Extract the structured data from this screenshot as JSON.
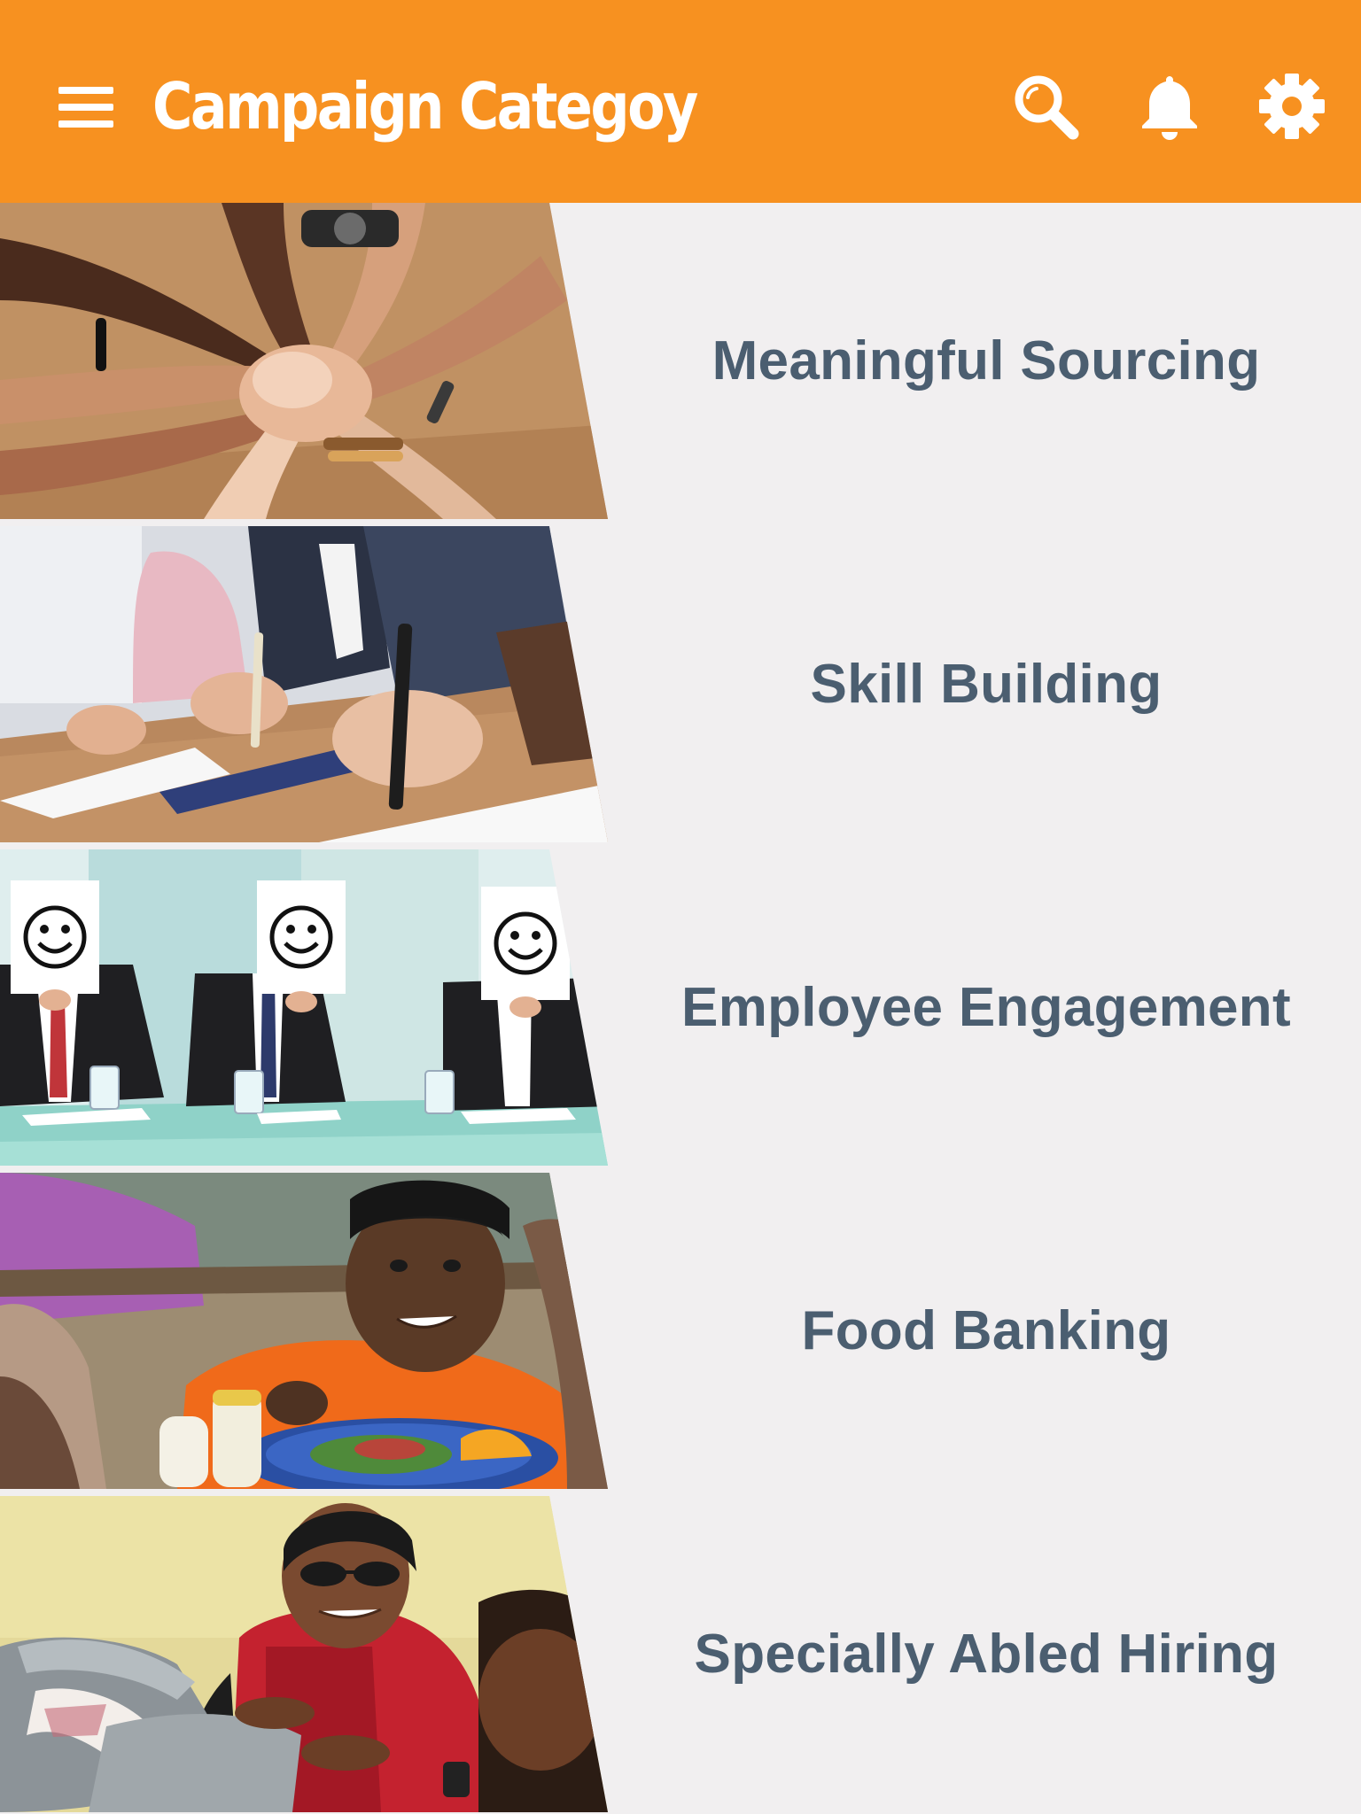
{
  "app_bar": {
    "title": "Campaign Categoy",
    "background_color": "#f79120",
    "menu_icon": "hamburger-menu-icon",
    "actions": [
      {
        "icon": "search-icon"
      },
      {
        "icon": "bell-icon"
      },
      {
        "icon": "gear-icon"
      }
    ]
  },
  "categories": [
    {
      "label": "Meaningful Sourcing",
      "image": "stacked-hands-photo"
    },
    {
      "label": "Skill Building",
      "image": "people-writing-at-table-photo"
    },
    {
      "label": "Employee Engagement",
      "image": "smiley-face-signs-photo"
    },
    {
      "label": "Food Banking",
      "image": "child-eating-lunch-photo"
    },
    {
      "label": "Specially Abled Hiring",
      "image": "woman-using-braille-typewriter-photo"
    }
  ],
  "colors": {
    "label_text": "#4b5e70",
    "list_background": "#f1eff0",
    "divider": "#ffffff"
  }
}
